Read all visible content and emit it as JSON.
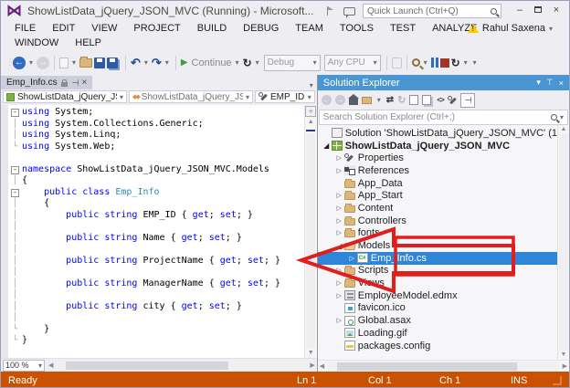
{
  "title_bar": {
    "title": "ShowListData_jQuery_JSON_MVC (Running) - Microsoft...",
    "quick_launch_placeholder": "Quick Launch (Ctrl+Q)"
  },
  "menu_bar": {
    "items": [
      "FILE",
      "EDIT",
      "VIEW",
      "PROJECT",
      "BUILD",
      "DEBUG",
      "TEAM",
      "TOOLS",
      "TEST",
      "ANALYZE",
      "WINDOW",
      "HELP"
    ],
    "user_name": "Rahul Saxena"
  },
  "toolbar": {
    "items": [
      {
        "type": "icon",
        "icon": "drag-handle",
        "interactable": false
      },
      {
        "type": "icon",
        "icon": "nav-back"
      },
      {
        "type": "caret"
      },
      {
        "type": "icon",
        "icon": "nav-forward",
        "disabled": true
      },
      {
        "type": "sep"
      },
      {
        "type": "icon",
        "icon": "new-file",
        "disabled": true
      },
      {
        "type": "caret"
      },
      {
        "type": "icon",
        "icon": "open-file"
      },
      {
        "type": "icon",
        "icon": "save"
      },
      {
        "type": "icon",
        "icon": "save-all"
      },
      {
        "type": "sep"
      },
      {
        "type": "icon",
        "icon": "undo"
      },
      {
        "type": "caret"
      },
      {
        "type": "icon",
        "icon": "redo"
      },
      {
        "type": "caret"
      },
      {
        "type": "sep"
      },
      {
        "type": "labeled",
        "icon": "continue-play",
        "label": "Continue"
      },
      {
        "type": "caret"
      },
      {
        "type": "icon",
        "icon": "restart"
      },
      {
        "type": "caret"
      },
      {
        "type": "combo",
        "name": "debug-configuration",
        "label": "Debug"
      },
      {
        "type": "combo",
        "name": "solution-platform",
        "label": "Any CPU"
      },
      {
        "type": "sep"
      },
      {
        "type": "icon",
        "icon": "attach-process",
        "disabled": true
      },
      {
        "type": "sep"
      },
      {
        "type": "icon",
        "icon": "find"
      },
      {
        "type": "caret"
      },
      {
        "type": "icon",
        "icon": "break-all"
      },
      {
        "type": "icon",
        "icon": "stop-debug"
      },
      {
        "type": "icon",
        "icon": "restart-app"
      },
      {
        "type": "caret"
      },
      {
        "type": "caret"
      }
    ]
  },
  "editor": {
    "tab_label": "Emp_Info.cs",
    "breadcrumb": {
      "project": "ShowListData_jQuery_JS",
      "type": "ShowListData_jQuery_JS",
      "member": "EMP_ID"
    },
    "zoom_level": "100 %",
    "code": {
      "lines": [
        {
          "f": "minus",
          "t": [
            [
              "using",
              "k"
            ],
            [
              " System;",
              "p"
            ]
          ]
        },
        {
          "f": "line",
          "t": [
            [
              "using",
              "k"
            ],
            [
              " System.Collections.Generic;",
              "p"
            ]
          ]
        },
        {
          "f": "line",
          "t": [
            [
              "using",
              "k"
            ],
            [
              " System.Linq;",
              "p"
            ]
          ]
        },
        {
          "f": "end",
          "t": [
            [
              "using",
              "k"
            ],
            [
              " System.Web;",
              "p"
            ]
          ]
        },
        {
          "f": "",
          "t": []
        },
        {
          "f": "minus",
          "t": [
            [
              "namespace",
              "k"
            ],
            [
              " ShowListData_jQuery_JSON_MVC.Models",
              "p"
            ]
          ]
        },
        {
          "f": "line",
          "t": [
            [
              "{",
              "p"
            ]
          ]
        },
        {
          "f": "minus",
          "t": [
            [
              "    ",
              "p"
            ],
            [
              "public class",
              "k"
            ],
            [
              " ",
              "p"
            ],
            [
              "Emp_Info",
              "t"
            ]
          ]
        },
        {
          "f": "line",
          "t": [
            [
              "    {",
              "p"
            ]
          ]
        },
        {
          "f": "line",
          "t": [
            [
              "        ",
              "p"
            ],
            [
              "public string",
              "k"
            ],
            [
              " EMP_ID { ",
              "p"
            ],
            [
              "get",
              "k"
            ],
            [
              "; ",
              "p"
            ],
            [
              "set",
              "k"
            ],
            [
              "; }",
              "p"
            ]
          ]
        },
        {
          "f": "line",
          "t": []
        },
        {
          "f": "line",
          "t": [
            [
              "        ",
              "p"
            ],
            [
              "public string",
              "k"
            ],
            [
              " Name { ",
              "p"
            ],
            [
              "get",
              "k"
            ],
            [
              "; ",
              "p"
            ],
            [
              "set",
              "k"
            ],
            [
              "; }",
              "p"
            ]
          ]
        },
        {
          "f": "line",
          "t": []
        },
        {
          "f": "line",
          "t": [
            [
              "        ",
              "p"
            ],
            [
              "public string",
              "k"
            ],
            [
              " ProjectName { ",
              "p"
            ],
            [
              "get",
              "k"
            ],
            [
              "; ",
              "p"
            ],
            [
              "set",
              "k"
            ],
            [
              "; }",
              "p"
            ]
          ]
        },
        {
          "f": "line",
          "t": []
        },
        {
          "f": "line",
          "t": [
            [
              "        ",
              "p"
            ],
            [
              "public string",
              "k"
            ],
            [
              " ManagerName { ",
              "p"
            ],
            [
              "get",
              "k"
            ],
            [
              "; ",
              "p"
            ],
            [
              "set",
              "k"
            ],
            [
              "; }",
              "p"
            ]
          ]
        },
        {
          "f": "line",
          "t": []
        },
        {
          "f": "line",
          "t": [
            [
              "        ",
              "p"
            ],
            [
              "public string",
              "k"
            ],
            [
              " city { ",
              "p"
            ],
            [
              "get",
              "k"
            ],
            [
              "; ",
              "p"
            ],
            [
              "set",
              "k"
            ],
            [
              "; }",
              "p"
            ]
          ]
        },
        {
          "f": "line",
          "t": []
        },
        {
          "f": "end",
          "t": [
            [
              "    }",
              "p"
            ]
          ]
        },
        {
          "f": "end",
          "t": [
            [
              "}",
              "p"
            ]
          ]
        }
      ]
    }
  },
  "solution_explorer": {
    "title": "Solution Explorer",
    "toolbar_icons": [
      "se-back",
      "se-forward",
      "home",
      "collapse-all",
      "caret",
      "sync-active",
      "refresh",
      "properties-page",
      "preview",
      "code-view",
      "wrench",
      "pin-pressed"
    ],
    "search_placeholder": "Search Solution Explorer (Ctrl+;)",
    "tree": [
      {
        "label": "Solution 'ShowListData_jQuery_JSON_MVC' (1",
        "icon": "solution",
        "indent": 0,
        "expander": "none"
      },
      {
        "label": "ShowListData_jQuery_JSON_MVC",
        "icon": "project",
        "indent": 0,
        "expander": "expanded",
        "bold": true
      },
      {
        "label": "Properties",
        "icon": "properties",
        "indent": 1,
        "expander": "collapsed"
      },
      {
        "label": "References",
        "icon": "references",
        "indent": 1,
        "expander": "collapsed"
      },
      {
        "label": "App_Data",
        "icon": "folder",
        "indent": 1,
        "expander": "none"
      },
      {
        "label": "App_Start",
        "icon": "folder",
        "indent": 1,
        "expander": "collapsed"
      },
      {
        "label": "Content",
        "icon": "folder",
        "indent": 1,
        "expander": "collapsed"
      },
      {
        "label": "Controllers",
        "icon": "folder",
        "indent": 1,
        "expander": "collapsed"
      },
      {
        "label": "fonts",
        "icon": "folder",
        "indent": 1,
        "expander": "collapsed"
      },
      {
        "label": "Models",
        "icon": "folder-open",
        "indent": 1,
        "expander": "expanded"
      },
      {
        "label": "Emp_Info.cs",
        "icon": "csharp-file",
        "indent": 2,
        "expander": "collapsed",
        "selected": true
      },
      {
        "label": "Scripts",
        "icon": "folder",
        "indent": 1,
        "expander": "collapsed"
      },
      {
        "label": "Views",
        "icon": "folder",
        "indent": 1,
        "expander": "collapsed"
      },
      {
        "label": "EmployeeModel.edmx",
        "icon": "edmx",
        "indent": 1,
        "expander": "collapsed"
      },
      {
        "label": "favicon.ico",
        "icon": "ico-file",
        "indent": 1,
        "expander": "none"
      },
      {
        "label": "Global.asax",
        "icon": "asax",
        "indent": 1,
        "expander": "collapsed"
      },
      {
        "label": "Loading.gif",
        "icon": "image-file",
        "indent": 1,
        "expander": "none"
      },
      {
        "label": "packages.config",
        "icon": "config-file",
        "indent": 1,
        "expander": "none"
      }
    ]
  },
  "status_bar": {
    "state": "Ready",
    "line": "Ln 1",
    "column": "Col 1",
    "character": "Ch 1",
    "mode": "INS"
  },
  "colors": {
    "status_bar": "#CA5100",
    "tool_window_header": "#4A96D2",
    "tree_selection": "#2F86D8",
    "keyword": "#0000FF",
    "type_name": "#2B91AF",
    "folder": "#DCB67A",
    "vs_logo": "#68217A",
    "annotation_red": "#E01E1E",
    "tab_inactive_selected": "#CCCEDB"
  }
}
